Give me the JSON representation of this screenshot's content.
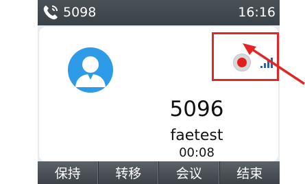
{
  "status_bar": {
    "extension": "5098",
    "time": "16:16",
    "icon": "phone-handset-icon"
  },
  "call": {
    "number": "5096",
    "name": "faetest",
    "duration": "00:08",
    "avatar_icon": "contact-avatar-icon",
    "recording_icon": "record-icon",
    "signal_icon": "signal-bars-icon"
  },
  "softkeys": [
    {
      "label": "保持"
    },
    {
      "label": "转移"
    },
    {
      "label": "会议"
    },
    {
      "label": "结束"
    }
  ],
  "colors": {
    "highlight": "#e22626",
    "avatar": "#2e9be8",
    "bar": "#3d4348"
  }
}
